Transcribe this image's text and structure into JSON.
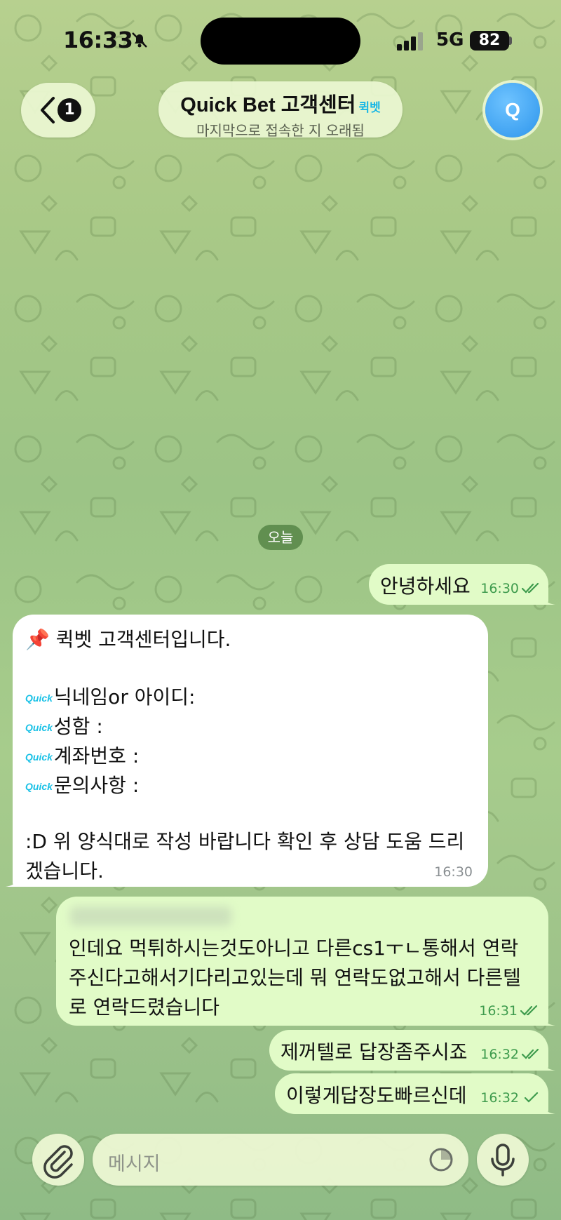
{
  "status_bar": {
    "time": "16:33",
    "network": "5G",
    "battery": "82"
  },
  "header": {
    "back_badge": "1",
    "title": "Quick Bet 고객센터",
    "title_tag": "퀵벳",
    "subtitle": "마지막으로 접속한 지 오래됨",
    "avatar_letter": "Q"
  },
  "chat": {
    "date_label": "오늘",
    "messages": [
      {
        "text": "안녕하세요",
        "time": "16:30",
        "status": "read"
      },
      {
        "lines": [
          "📌 퀵벳 고객센터입니다.",
          "",
          "닉네임or 아이디:",
          "성함 :",
          "계좌번호 :",
          "문의사항 :",
          "",
          ":D 위 양식대로 작성 바랍니다 확인 후 상담 도움 드리",
          "겠습니다."
        ],
        "field_prefix": "Quick",
        "time": "16:30"
      },
      {
        "lines": [
          "인데요 먹튀하시는것도아니고 다른cs1ㅜㄴ통해서 연락",
          "주신다고해서기다리고있는데 뭐 연락도없고해서 다른텔",
          "로 연락드렸습니다"
        ],
        "time": "16:31",
        "status": "read"
      },
      {
        "text": "제꺼텔로 답장좀주시죠",
        "time": "16:32",
        "status": "read"
      },
      {
        "text": "이렇게답장도빠르신데",
        "time": "16:32",
        "status": "sent"
      }
    ]
  },
  "composer": {
    "placeholder": "메시지"
  },
  "colors": {
    "outgoing_bubble": "#e1fbc7",
    "incoming_bubble": "#ffffff",
    "accent": "#3e9b4d",
    "tag": "#17b6e6"
  },
  "icons": [
    "bell-off-icon",
    "signal-icon",
    "chevron-left-icon",
    "double-check-icon",
    "check-icon",
    "paperclip-icon",
    "sticker-icon",
    "microphone-icon"
  ]
}
